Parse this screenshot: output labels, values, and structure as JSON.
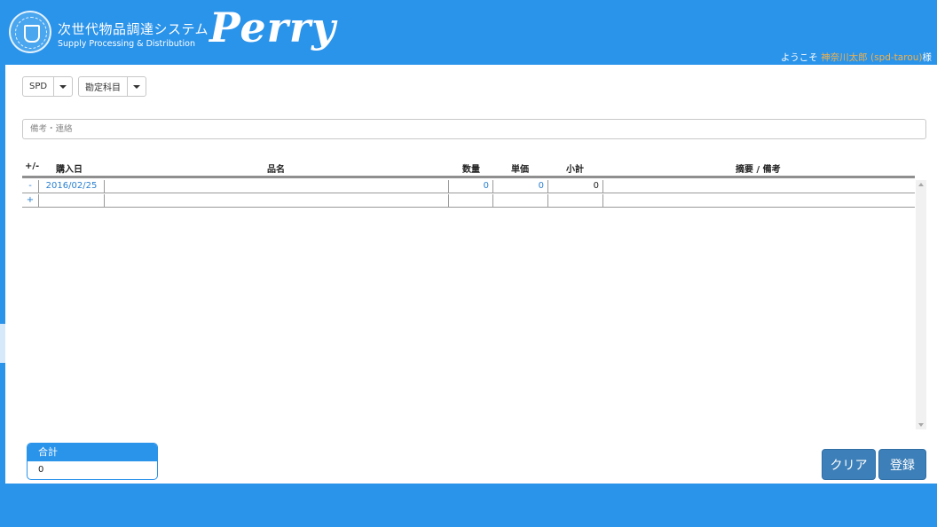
{
  "header": {
    "system_title": "次世代物品調達システム",
    "system_subtitle": "Supply Processing & Distribution",
    "brand": "Perry",
    "welcome_prefix": "ようこそ",
    "user_name": "神奈川太郎",
    "user_id": "(spd-tarou)",
    "welcome_suffix": "様"
  },
  "filters": {
    "dropdown1": "SPD",
    "dropdown2": "勘定科目"
  },
  "memo": {
    "placeholder": "備考・連絡"
  },
  "table": {
    "headers": {
      "plus_minus": "+/-",
      "date": "購入日",
      "item_name": "品名",
      "quantity": "数量",
      "unit_price": "単価",
      "subtotal": "小計",
      "note": "摘要 / 備考"
    },
    "rows": [
      {
        "action": "-",
        "date": "2016/02/25",
        "item_name": "",
        "quantity": "0",
        "unit_price": "0",
        "subtotal": "0",
        "note": ""
      },
      {
        "action": "+",
        "date": "",
        "item_name": "",
        "quantity": "",
        "unit_price": "",
        "subtotal": "",
        "note": ""
      }
    ]
  },
  "total": {
    "label": "合計",
    "value": "0"
  },
  "buttons": {
    "clear": "クリア",
    "register": "登録"
  },
  "colors": {
    "primary": "#2a93ea",
    "button": "#3d7fb8",
    "link": "#2a7fd0",
    "username": "#f2b24a"
  }
}
